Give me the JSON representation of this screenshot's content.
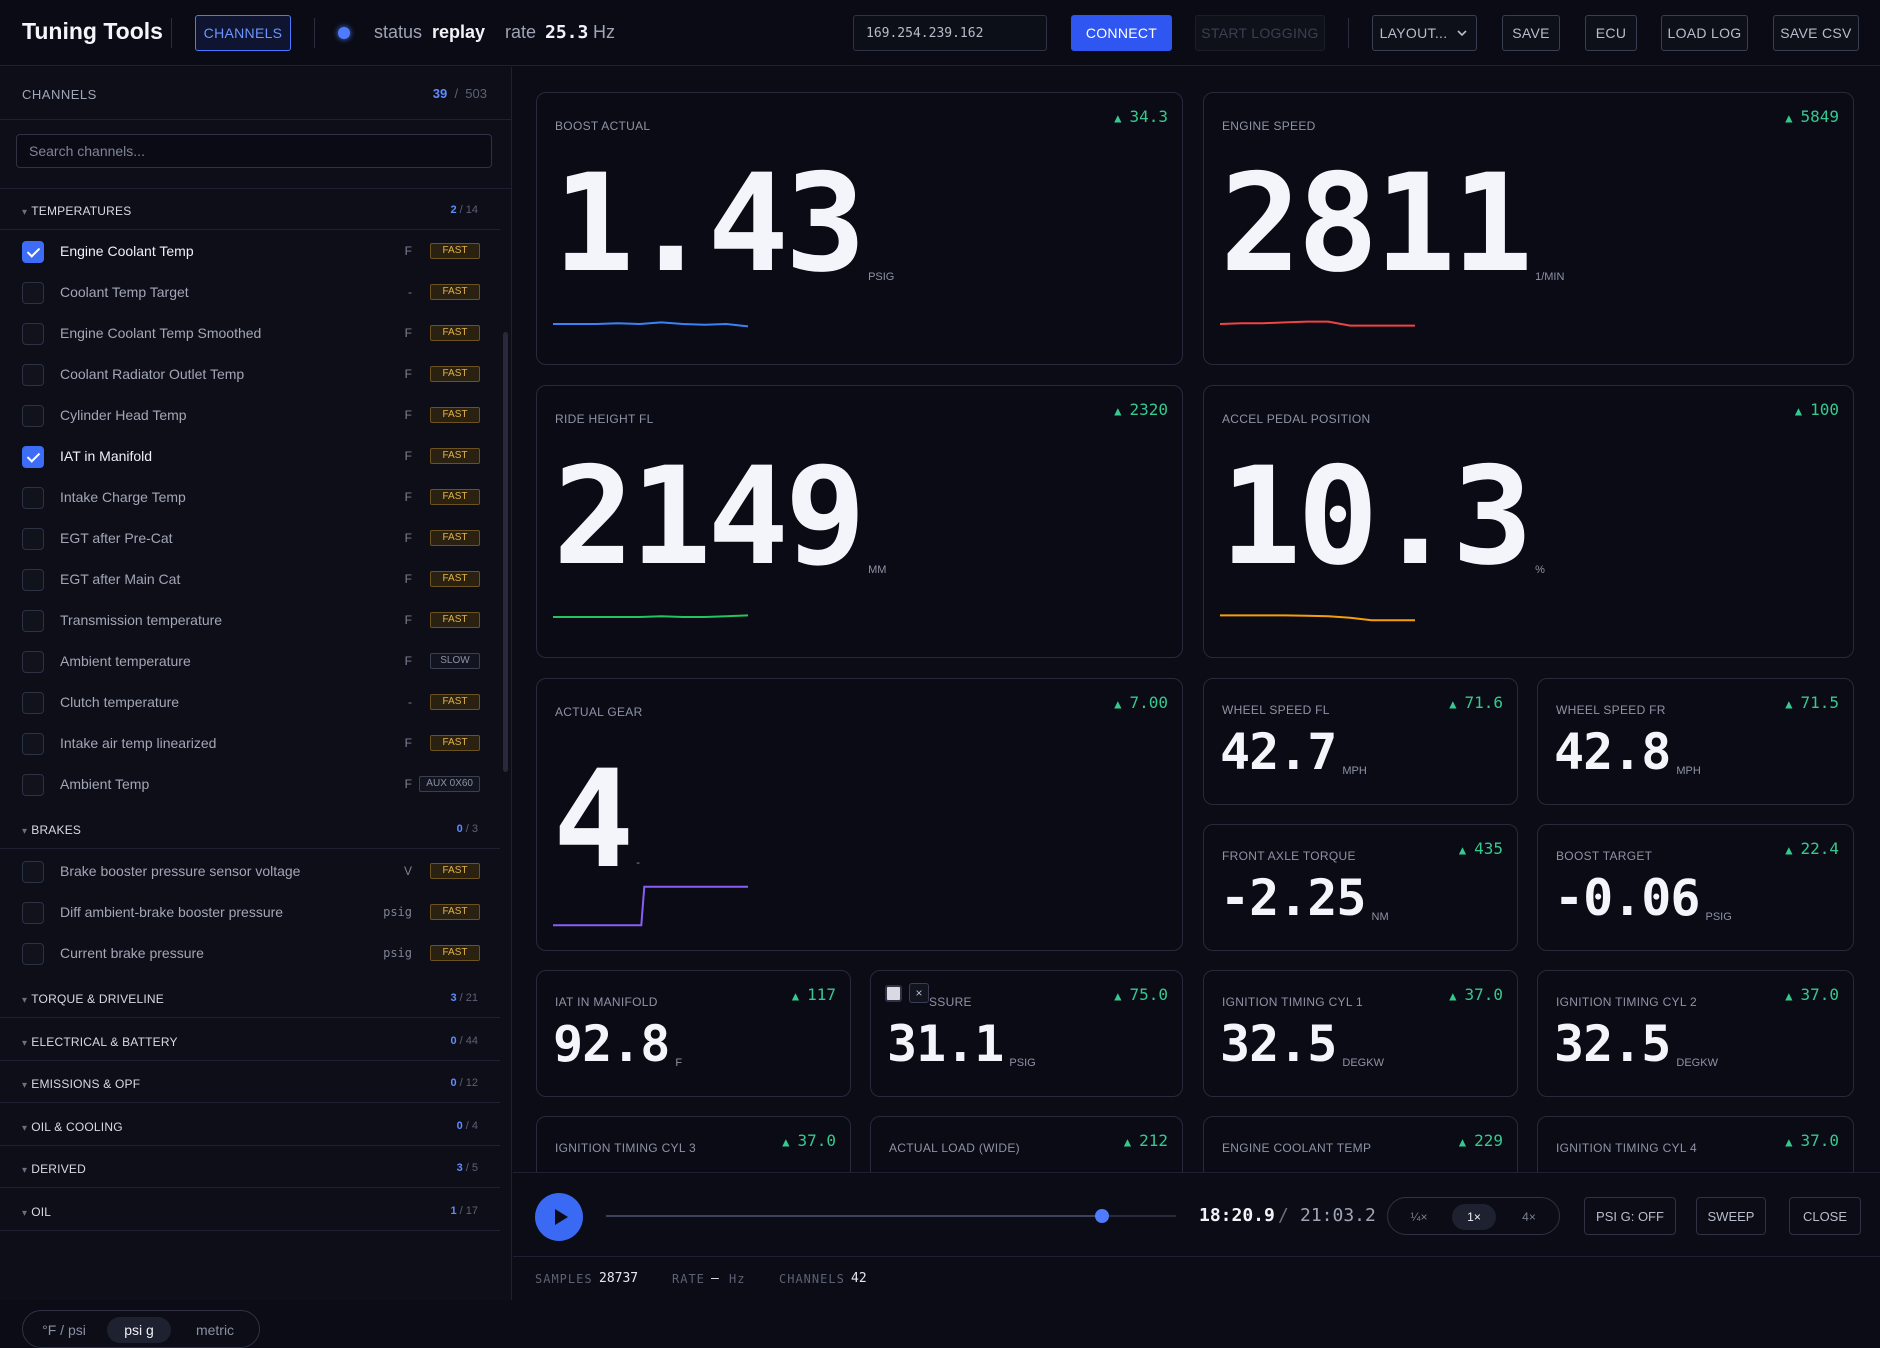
{
  "topbar": {
    "title": "Tuning Tools",
    "channels_btn": "CHANNELS",
    "status_label": "status",
    "status_value": "replay",
    "rate_label": "rate",
    "rate_value": "25.3",
    "rate_unit": "Hz",
    "ip_value": "169.254.239.162",
    "connect": "CONNECT",
    "start_logging": "START LOGGING",
    "layout": "LAYOUT...",
    "save": "SAVE",
    "ecu": "ECU",
    "load_log": "LOAD LOG",
    "save_csv": "SAVE CSV"
  },
  "sidebar": {
    "header": "CHANNELS",
    "selected_count": "39",
    "total_count": "503",
    "search_placeholder": "Search channels...",
    "groups": [
      {
        "name": "TEMPERATURES",
        "sel": "2",
        "total": "14"
      },
      {
        "name": "BRAKES",
        "sel": "0",
        "total": "3"
      },
      {
        "name": "TORQUE & DRIVELINE",
        "sel": "3",
        "total": "21"
      },
      {
        "name": "ELECTRICAL & BATTERY",
        "sel": "0",
        "total": "44"
      },
      {
        "name": "EMISSIONS & OPF",
        "sel": "0",
        "total": "12"
      },
      {
        "name": "OIL & COOLING",
        "sel": "0",
        "total": "4"
      },
      {
        "name": "DERIVED",
        "sel": "3",
        "total": "5"
      },
      {
        "name": "OIL",
        "sel": "1",
        "total": "17"
      }
    ],
    "temperatures": [
      {
        "label": "Engine Coolant Temp",
        "unit": "F",
        "tag": "FAST",
        "checked": true
      },
      {
        "label": "Coolant Temp Target",
        "unit": "-",
        "tag": "FAST",
        "checked": false
      },
      {
        "label": "Engine Coolant Temp Smoothed",
        "unit": "F",
        "tag": "FAST",
        "checked": false
      },
      {
        "label": "Coolant Radiator Outlet Temp",
        "unit": "F",
        "tag": "FAST",
        "checked": false
      },
      {
        "label": "Cylinder Head Temp",
        "unit": "F",
        "tag": "FAST",
        "checked": false
      },
      {
        "label": "IAT in Manifold",
        "unit": "F",
        "tag": "FAST",
        "checked": true
      },
      {
        "label": "Intake Charge Temp",
        "unit": "F",
        "tag": "FAST",
        "checked": false
      },
      {
        "label": "EGT after Pre-Cat",
        "unit": "F",
        "tag": "FAST",
        "checked": false
      },
      {
        "label": "EGT after Main Cat",
        "unit": "F",
        "tag": "FAST",
        "checked": false
      },
      {
        "label": "Transmission temperature",
        "unit": "F",
        "tag": "FAST",
        "checked": false
      },
      {
        "label": "Ambient temperature",
        "unit": "F",
        "tag": "SLOW",
        "checked": false
      },
      {
        "label": "Clutch temperature",
        "unit": "-",
        "tag": "FAST",
        "checked": false
      },
      {
        "label": "Intake air temp linearized",
        "unit": "F",
        "tag": "FAST",
        "checked": false
      },
      {
        "label": "Ambient Temp",
        "unit": "F",
        "tag": "AUX 0X60",
        "checked": false
      }
    ],
    "brakes": [
      {
        "label": "Brake booster pressure sensor voltage",
        "unit": "V",
        "tag": "FAST",
        "checked": false
      },
      {
        "label": "Diff ambient-brake booster pressure",
        "unit": "psig",
        "tag": "FAST",
        "checked": false
      },
      {
        "label": "Current brake pressure",
        "unit": "psig",
        "tag": "FAST",
        "checked": false
      }
    ],
    "units": [
      "°F / psi",
      "psi g",
      "metric"
    ],
    "active_unit": 1
  },
  "cards": [
    {
      "title": "BOOST ACTUAL",
      "peak": "34.3",
      "value": "1.43",
      "unit": "PSIG",
      "color": "#3b82f6",
      "spark": [
        0.5,
        0.5,
        0.5,
        0.45,
        0.5,
        0.4,
        0.5,
        0.55,
        0.5,
        0.65
      ]
    },
    {
      "title": "ENGINE SPEED",
      "peak": "5849",
      "value": "2811",
      "unit": "1/MIN",
      "color": "#ef4444",
      "spark": [
        0.5,
        0.45,
        0.45,
        0.4,
        0.35,
        0.35,
        0.6,
        0.6,
        0.6,
        0.6
      ]
    },
    {
      "title": "RIDE HEIGHT FL",
      "peak": "2320",
      "value": "2149",
      "unit": "MM",
      "color": "#22c55e",
      "spark": [
        0.5,
        0.5,
        0.5,
        0.5,
        0.5,
        0.45,
        0.5,
        0.5,
        0.45,
        0.4
      ]
    },
    {
      "title": "ACCEL PEDAL POSITION",
      "peak": "100",
      "value": "10.3",
      "unit": "%",
      "color": "#f59e0b",
      "spark": [
        0.4,
        0.4,
        0.4,
        0.4,
        0.42,
        0.45,
        0.55,
        0.7,
        0.7,
        0.7
      ]
    },
    {
      "title": "ACTUAL GEAR",
      "peak": "7.00",
      "value": "4",
      "unit": "-",
      "color": "#8b5cf6",
      "spark": [
        0.9,
        0.9,
        0.9,
        0.9,
        0.9,
        0.1,
        0.1,
        0.1,
        0.1,
        0.1
      ]
    },
    {
      "title": "WHEEL SPEED FL",
      "peak": "71.6",
      "value": "42.7",
      "unit": "MPH"
    },
    {
      "title": "WHEEL SPEED FR",
      "peak": "71.5",
      "value": "42.8",
      "unit": "MPH"
    },
    {
      "title": "FRONT AXLE TORQUE",
      "peak": "435",
      "value": "-2.25",
      "unit": "NM"
    },
    {
      "title": "BOOST TARGET",
      "peak": "22.4",
      "value": "-0.06",
      "unit": "PSIG"
    },
    {
      "title": "IAT IN MANIFOLD",
      "peak": "117",
      "value": "92.8",
      "unit": "F"
    },
    {
      "title": "SSURE",
      "peak": "75.0",
      "value": "31.1",
      "unit": "PSIG"
    },
    {
      "title": "IGNITION TIMING CYL 1",
      "peak": "37.0",
      "value": "32.5",
      "unit": "DEGKW"
    },
    {
      "title": "IGNITION TIMING CYL 2",
      "peak": "37.0",
      "value": "32.5",
      "unit": "DEGKW"
    },
    {
      "title": "IGNITION TIMING CYL 3",
      "peak": "37.0",
      "value": "",
      "unit": ""
    },
    {
      "title": "ACTUAL LOAD (WIDE)",
      "peak": "212",
      "value": "",
      "unit": ""
    },
    {
      "title": "ENGINE COOLANT TEMP",
      "peak": "229",
      "value": "",
      "unit": ""
    },
    {
      "title": "IGNITION TIMING CYL 4",
      "peak": "37.0",
      "value": "",
      "unit": ""
    }
  ],
  "playback": {
    "current": "18:20.9",
    "separator": "/",
    "total": "21:03.2",
    "progress": 0.87,
    "speeds": [
      "¼×",
      "1×",
      "4×"
    ],
    "active_speed": 1,
    "psi_g": "PSI G: OFF",
    "sweep": "SWEEP",
    "close": "CLOSE",
    "card_checkbox_close": "×"
  },
  "statusbar": {
    "samples_label": "SAMPLES",
    "samples": "28737",
    "rate_label": "RATE",
    "rate": "—",
    "rate_unit": "Hz",
    "channels_label": "CHANNELS",
    "channels": "42"
  }
}
